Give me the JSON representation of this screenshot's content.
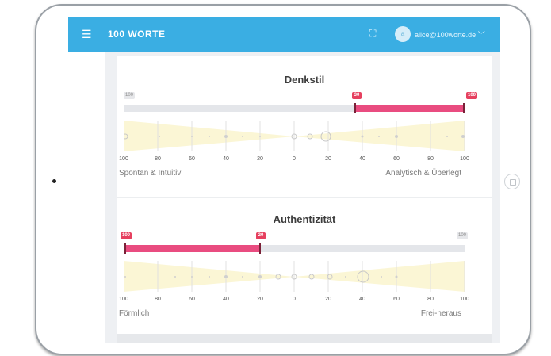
{
  "app": {
    "menu_icon": "hamburger-icon",
    "brand": "100 WORTE",
    "expand_icon": "fullscreen-icon",
    "avatar_initial": "a",
    "user_email": "alice@100worte.de"
  },
  "scales": [
    {
      "title": "Denkstil",
      "range": {
        "from": 30,
        "to": 100,
        "side": "right",
        "direction": "right"
      },
      "badge_left": "100",
      "badge_range_start": "30",
      "badge_range_end": "100",
      "axis_ticks": [
        "100",
        "80",
        "60",
        "40",
        "20",
        "0",
        "20",
        "40",
        "60",
        "80",
        "100"
      ],
      "label_left": "Spontan & Intuitiv",
      "label_right": "Analytisch & Überlegt"
    },
    {
      "title": "Authentizität",
      "range": {
        "from": 100,
        "to": 20,
        "side": "left",
        "direction": "left"
      },
      "badge_range_start": "100",
      "badge_range_end": "20",
      "badge_right": "100",
      "axis_ticks": [
        "100",
        "80",
        "60",
        "40",
        "20",
        "0",
        "20",
        "40",
        "60",
        "80",
        "100"
      ],
      "label_left": "Förmlich",
      "label_right": "Frei-heraus"
    }
  ],
  "colors": {
    "topbar": "#3aaee3",
    "accent": "#e94c80",
    "band": "#fbf6d5"
  }
}
